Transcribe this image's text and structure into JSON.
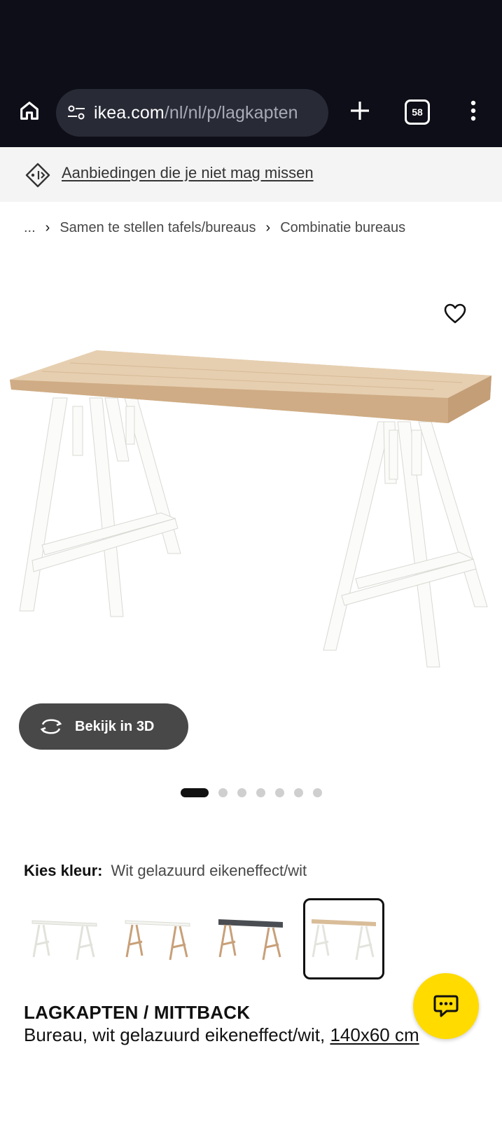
{
  "browser": {
    "url_domain": "ikea.com",
    "url_path": "/nl/nl/p/lagkapten",
    "tab_count": "58"
  },
  "promo": {
    "text": "Aanbiedingen die je niet mag missen"
  },
  "breadcrumb": {
    "items": [
      "...",
      "Samen te stellen tafels/bureaus",
      "Combinatie bureaus"
    ],
    "separator": "›"
  },
  "gallery": {
    "view3d_label": "Bekijk in 3D",
    "image_count": 7,
    "active_index": 0
  },
  "color": {
    "label": "Kies kleur:",
    "value": "Wit gelazuurd eikeneffect/wit",
    "swatches": [
      {
        "top": "#f4f4f0",
        "legs": "#f0f0ec"
      },
      {
        "top": "#f6f6f2",
        "legs": "#c8a079"
      },
      {
        "top": "#4a4e52",
        "legs": "#c8a079"
      },
      {
        "top": "#ddc2a0",
        "legs": "#f0f0ec"
      }
    ],
    "selected_index": 3
  },
  "product": {
    "name": "LAGKAPTEN / MITTBACK",
    "description": "Bureau, wit gelazuurd eikeneffect/wit,",
    "size": "140x60 cm"
  },
  "colors": {
    "top_bar": "#0d0e17",
    "url_pill": "#282a36",
    "chat": "#ffdb00",
    "view3d": "#484848"
  }
}
